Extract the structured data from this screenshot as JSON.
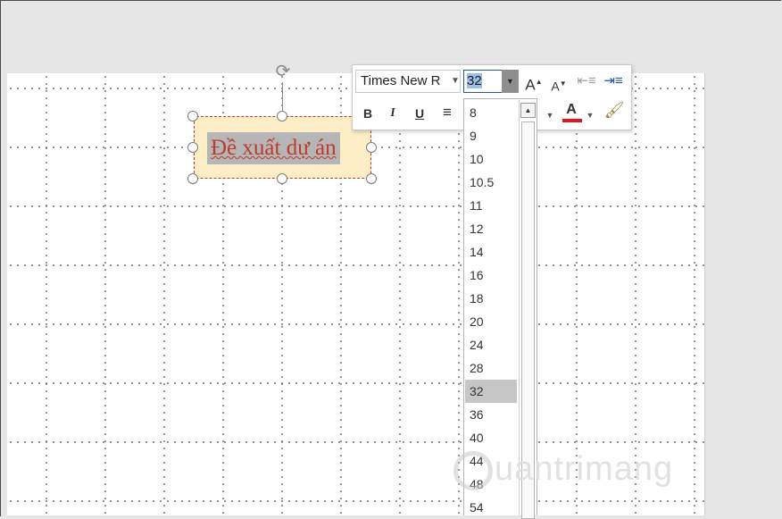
{
  "textbox": {
    "text": "Đề xuất dự án"
  },
  "mini_toolbar": {
    "font_name": "Times New R",
    "font_size": "32",
    "grow_font_icon": "A",
    "shrink_font_icon": "A",
    "bold_label": "B",
    "italic_label": "I",
    "underline_label": "U",
    "font_color_label": "A",
    "font_color": "#e0161c",
    "icons": {
      "rotate": "rotate-handle-icon",
      "decrease_indent": "decrease-indent-icon",
      "increase_indent": "increase-indent-icon",
      "align": "align-left-icon",
      "format_painter": "format-painter-icon"
    }
  },
  "font_size_list": {
    "options": [
      "8",
      "9",
      "10",
      "10.5",
      "11",
      "12",
      "14",
      "16",
      "18",
      "20",
      "24",
      "28",
      "32",
      "36",
      "40",
      "44",
      "48",
      "54"
    ],
    "selected": "32"
  },
  "watermark": {
    "text": "uantrimang"
  }
}
